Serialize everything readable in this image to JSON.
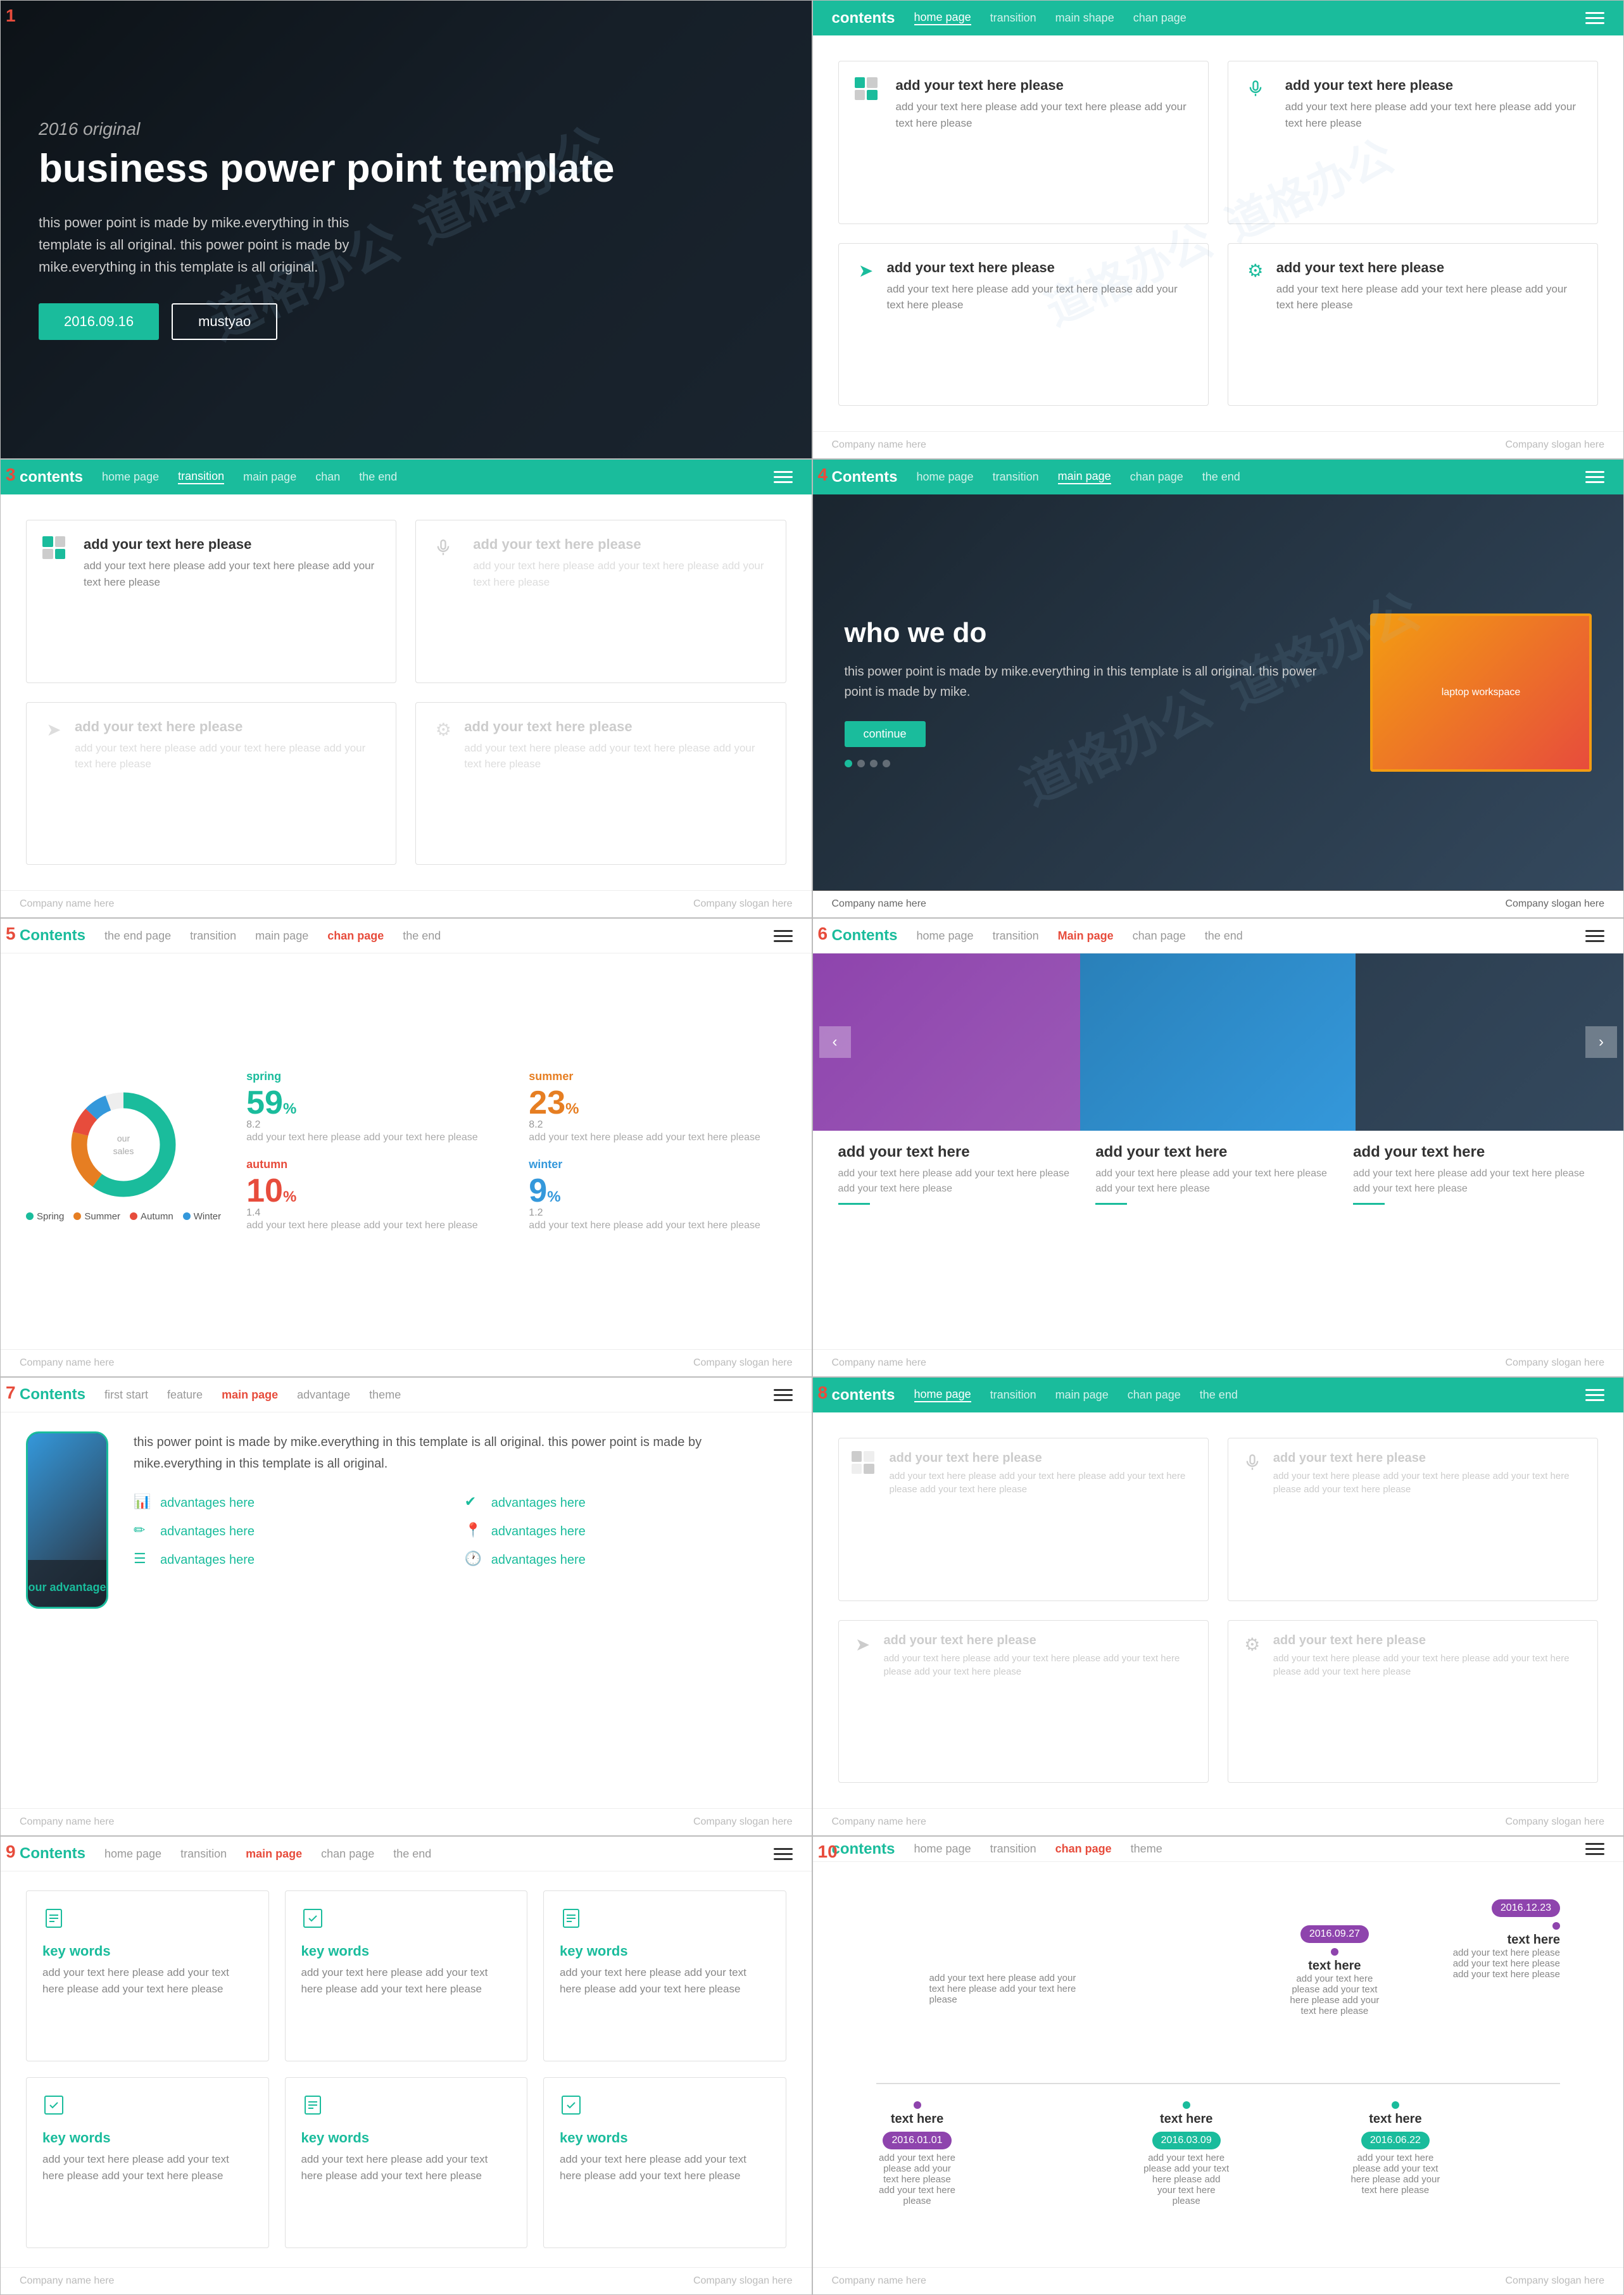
{
  "slides": [
    {
      "number": "1",
      "year": "2016 original",
      "title": "business power point template",
      "description": "this power point is made by mike.everything in this template is all original. this power point is made by mike.everything in this template is all original.",
      "btn1": "2016.09.16",
      "btn2": "mustyao",
      "watermark": "道格办公"
    },
    {
      "number": "2",
      "nav_title": "contents",
      "nav_items": [
        "home page",
        "transition",
        "main shape",
        "chan page"
      ],
      "cards": [
        {
          "title": "add your text here please",
          "desc": "add your text here please add your text here please add your text here please"
        },
        {
          "title": "add your text here please",
          "desc": "add your text here please add your text here please add your text here please"
        },
        {
          "title": "add your text here please",
          "desc": "add your text here please add your text here please add your text here please"
        },
        {
          "title": "add your text here please",
          "desc": "add your text here please add your text here please add your text here please"
        }
      ],
      "footer_left": "Company name here",
      "footer_right": "Company slogan here"
    },
    {
      "number": "3",
      "nav_title": "contents",
      "nav_items": [
        "home page",
        "transition",
        "main page",
        "chan",
        "the end"
      ],
      "cards": [
        {
          "title": "add your text here please",
          "desc": "add your text here please add your text here please add your text here please",
          "active": true
        },
        {
          "title": "add your text here please",
          "desc": "add your text here please add your text here please add your text here please",
          "active": false
        },
        {
          "title": "add your text here please",
          "desc": "add your text here please add your text here please add your text here please",
          "active": false
        },
        {
          "title": "add your text here please",
          "desc": "add your text here please add your text here please add your text here please",
          "active": false
        }
      ],
      "footer_left": "Company name here",
      "footer_right": "Company slogan here"
    },
    {
      "number": "4",
      "nav_title": "Contents",
      "nav_items": [
        "home page",
        "transition",
        "main page",
        "chan page",
        "the end"
      ],
      "heading": "who we do",
      "body_text": "this power point is made by mike.everything in this template is all original. this power point is made by mike.",
      "btn_label": "continue",
      "footer_left": "Company name here",
      "footer_right": "Company slogan here"
    },
    {
      "number": "5",
      "nav_title": "Contents",
      "nav_items": [
        "the end page",
        "transition",
        "main page",
        "chan page",
        "the end"
      ],
      "seasons": [
        {
          "name": "spring",
          "value": "59",
          "sub": "8.2",
          "desc": "add your text here please add your text here please",
          "color": "#1abc9c"
        },
        {
          "name": "summer",
          "value": "23",
          "sub": "8.2",
          "desc": "add your text here please add your text here please",
          "color": "#e67e22"
        },
        {
          "name": "autumn",
          "value": "10",
          "sub": "1.4",
          "desc": "add your text here please add your text here please",
          "color": "#e74c3c"
        },
        {
          "name": "winter",
          "value": "9",
          "sub": "1.2",
          "desc": "add your text here please add your text here please",
          "color": "#3498db"
        }
      ],
      "chart_label": "our sales",
      "legend": [
        "Spring",
        "Summer",
        "Autumn",
        "Winter"
      ],
      "footer_left": "Company name here",
      "footer_right": "Company slogan here"
    },
    {
      "number": "6",
      "nav_title": "Contents",
      "nav_items": [
        "home page",
        "transition",
        "Main page",
        "chan page",
        "the end"
      ],
      "cards": [
        {
          "title": "add your text here",
          "desc": "add your text here please add your text here please add your text here please"
        },
        {
          "title": "add your text here",
          "desc": "add your text here please add your text here please add your text here please"
        },
        {
          "title": "add your text here",
          "desc": "add your text here please add your text here please add your text here please"
        }
      ],
      "footer_left": "Company name here",
      "footer_right": "Company slogan here"
    },
    {
      "number": "7",
      "nav_title": "Contents",
      "nav_items": [
        "first start",
        "feature",
        "main page",
        "advantage",
        "theme"
      ],
      "phone_label": "our advantage",
      "body_text": "this power point is made by mike.everything in this template is all original. this power point is made by mike.everything in this template is all original.",
      "advantages": [
        "advantages here",
        "advantages here",
        "advantages here",
        "advantages here",
        "advantages here",
        "advantages here"
      ],
      "footer_left": "Company name here",
      "footer_right": "Company slogan here"
    },
    {
      "number": "8",
      "nav_title": "contents",
      "nav_items": [
        "home page",
        "transition",
        "main page",
        "chan page",
        "the end"
      ],
      "cards": [
        {
          "title": "add your text here please",
          "desc": "add your text here please add your text here please add your text here please add your text here please"
        },
        {
          "title": "add your text here please",
          "desc": "add your text here please add your text here please add your text here please add your text here please"
        },
        {
          "title": "add your text here please",
          "desc": "add your text here please add your text here please add your text here please add your text here please"
        },
        {
          "title": "add your text here please",
          "desc": "add your text here please add your text here please add your text here please add your text here please"
        }
      ],
      "footer_left": "Company name here",
      "footer_right": "Company slogan here"
    },
    {
      "number": "9",
      "nav_title": "Contents",
      "nav_items": [
        "home page",
        "transition",
        "main page",
        "chan page",
        "the end"
      ],
      "cards": [
        {
          "keyword": "key words",
          "desc": "add your text here please add your text here please add your text here please"
        },
        {
          "keyword": "key words",
          "desc": "add your text here please add your text here please add your text here please"
        },
        {
          "keyword": "key words",
          "desc": "add your text here please add your text here please add your text here please"
        },
        {
          "keyword": "key words",
          "desc": "add your text here please add your text here please add your text here please"
        },
        {
          "keyword": "key words",
          "desc": "add your text here please add your text here please add your text here please"
        },
        {
          "keyword": "key words",
          "desc": "add your text here please add your text here please add your text here please"
        }
      ],
      "footer_left": "Company name here",
      "footer_right": "Company slogan here"
    },
    {
      "number": "10",
      "nav_title": "contents",
      "nav_items": [
        "home page",
        "transition",
        "chan page",
        "theme"
      ],
      "timeline_items": [
        {
          "date": "2016.12.23",
          "label": "text here",
          "desc": "add your text here please add your text here please add your text here please",
          "style": "top",
          "pos": "75%",
          "badge": "purple"
        },
        {
          "date": "2016.09.27",
          "label": "text here",
          "desc": "add your text here please add your text here please add your text here please",
          "style": "top",
          "pos": "55%",
          "badge": "purple"
        },
        {
          "date": "2016.06.22",
          "label": "text here",
          "desc": "add your text here please add your text here please add your text here please",
          "style": "bottom",
          "pos": "70%",
          "badge": "teal"
        },
        {
          "date": "2016.03.09",
          "label": "text here",
          "desc": "add your text here please add your text here please add your text here please",
          "style": "bottom",
          "pos": "45%",
          "badge": "teal"
        },
        {
          "date": "2016.01.01",
          "label": "text here",
          "desc": "add your text here please add your text here please add your text here please",
          "style": "bottom",
          "pos": "20%",
          "badge": "purple"
        }
      ],
      "footer_left": "Company name here",
      "footer_right": "Company slogan here"
    }
  ]
}
